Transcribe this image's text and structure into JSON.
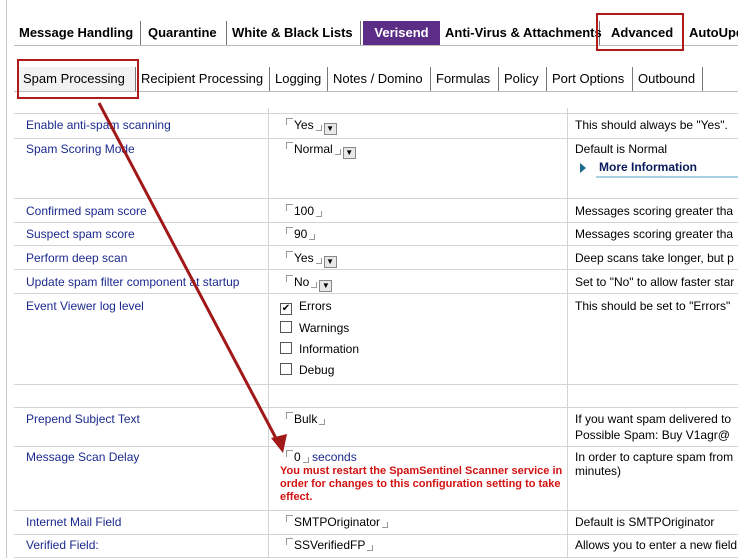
{
  "top_tabs": [
    {
      "label": "Message Handling"
    },
    {
      "label": "Quarantine"
    },
    {
      "label": "White & Black Lists"
    },
    {
      "label": "Verisend"
    },
    {
      "label": "Anti-Virus & Attachments"
    },
    {
      "label": "Advanced"
    },
    {
      "label": "AutoUpd"
    }
  ],
  "sub_tabs": [
    {
      "label": "Spam Processing"
    },
    {
      "label": "Recipient Processing"
    },
    {
      "label": "Logging"
    },
    {
      "label": "Notes / Domino"
    },
    {
      "label": "Formulas"
    },
    {
      "label": "Policy"
    },
    {
      "label": "Port Options"
    },
    {
      "label": "Outbound"
    }
  ],
  "rows": {
    "anti_spam": {
      "label": "Enable anti-spam scanning",
      "value": "Yes",
      "desc": "This should always be \"Yes\"."
    },
    "scoring_mode": {
      "label": "Spam Scoring Mode",
      "value": "Normal",
      "desc": "Default is Normal",
      "more": "More Information"
    },
    "confirmed": {
      "label": "Confirmed spam score",
      "value": "100",
      "desc": "Messages scoring greater tha"
    },
    "suspect": {
      "label": "Suspect spam score",
      "value": "90",
      "desc": "Messages scoring greater tha"
    },
    "deep_scan": {
      "label": "Perform deep scan",
      "value": "Yes",
      "desc": "Deep scans take longer, but p"
    },
    "update_filter": {
      "label": "Update spam filter component at startup",
      "value": "No",
      "desc": "Set to \"No\" to allow faster star"
    },
    "event_log": {
      "label": "Event Viewer log level",
      "options": [
        "Errors",
        "Warnings",
        "Information",
        "Debug"
      ],
      "checked": [
        "Errors"
      ],
      "desc": "This should be set to \"Errors\""
    },
    "prepend": {
      "label": "Prepend Subject Text",
      "value": "Bulk",
      "desc1": "If you want spam delivered to",
      "desc2": "Possible Spam:  Buy V1agr@"
    },
    "scan_delay": {
      "label": "Message Scan Delay",
      "value": "0",
      "unit": "seconds",
      "warning": "You must restart the SpamSentinel Scanner service in order for changes to this configuration setting to take effect.",
      "desc1": "In order to capture spam from",
      "desc2": "minutes)"
    },
    "internet_mail": {
      "label": "Internet Mail Field",
      "value": "SMTPOriginator",
      "desc": "Default is SMTPOriginator"
    },
    "verified": {
      "label": "Verified Field:",
      "value": "SSVerifiedFP",
      "desc": "Allows you to enter a new field"
    }
  },
  "colors": {
    "accent": "#5b2d86",
    "highlight": "#b11a1a",
    "link": "#1b2a8c",
    "warning": "#d21212"
  }
}
